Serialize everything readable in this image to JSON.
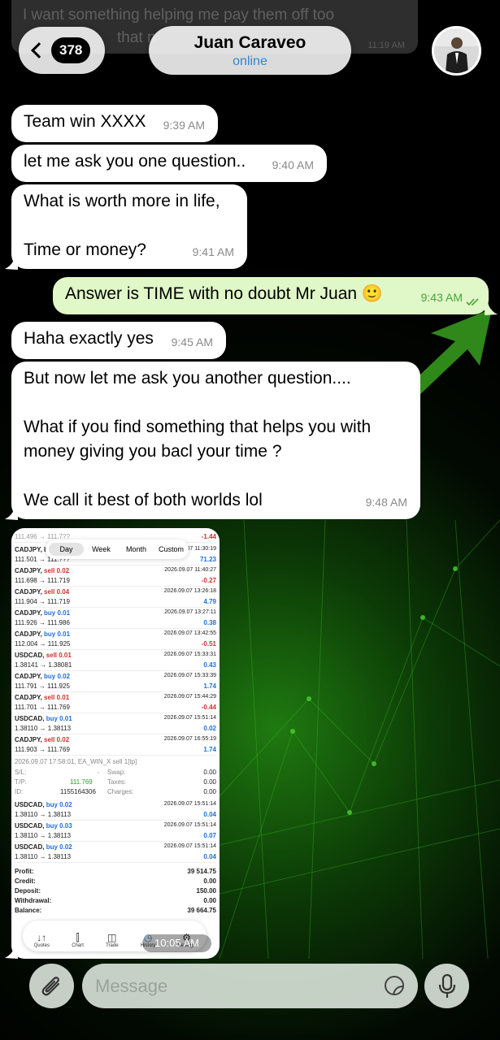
{
  "header": {
    "unread_count": "378",
    "contact_name": "Juan Caraveo",
    "contact_status": "online"
  },
  "ghost_message": {
    "text": "I want something helping me pay them off too",
    "line2": "that n",
    "time": "11:19 AM"
  },
  "messages": [
    {
      "dir": "in",
      "text": "Team win XXXX",
      "time": "9:39 AM"
    },
    {
      "dir": "in",
      "text": "let me ask you one question..",
      "time": "9:40 AM"
    },
    {
      "dir": "in",
      "text": "What is worth more in life,\n\nTime or money?",
      "time": "9:41 AM"
    },
    {
      "dir": "out",
      "text": "Answer is TIME with no doubt Mr Juan 🙂",
      "time": "9:43 AM"
    },
    {
      "dir": "in",
      "text": "Haha exactly yes",
      "time": "9:45 AM"
    },
    {
      "dir": "in",
      "text": "But now let me ask you another question....\n\nWhat if you find something that helps you with money giving you bacl your time ?\n\nWe call it best of both worlds lol",
      "time": "9:48 AM"
    }
  ],
  "screenshot_attachment": {
    "time": "10:05 AM",
    "segment": [
      "Day",
      "Week",
      "Month",
      "Custom"
    ],
    "partial_rows": [
      {
        "line1": "111.496 → 111.7??",
        "value": "-1.44"
      },
      {
        "pair": "CADJPY, bu",
        "side": "",
        "line2": "111.501 → 111.???",
        "stamp": "2026.09.07 11:30:19",
        "value": "71.23"
      }
    ],
    "trades": [
      {
        "pair": "CADJPY,",
        "side": "sell 0.02",
        "prices": "111.698 → 111.719",
        "stamp": "2026.09.07 11:40:27",
        "value": "-0.27",
        "kind": "sell"
      },
      {
        "pair": "CADJPY,",
        "side": "sell 0.04",
        "prices": "111.904 → 111.719",
        "stamp": "2026.09.07 13:26:18",
        "value": "4.79",
        "kind": "sell"
      },
      {
        "pair": "CADJPY,",
        "side": "buy 0.01",
        "prices": "111.926 → 111.986",
        "stamp": "2026.09.07 13:27:11",
        "value": "0.38",
        "kind": "buy"
      },
      {
        "pair": "CADJPY,",
        "side": "buy 0.01",
        "prices": "112.004 → 111.925",
        "stamp": "2026.09.07 13:42:55",
        "value": "-0.51",
        "kind": "buy"
      },
      {
        "pair": "USDCAD,",
        "side": "sell 0.01",
        "prices": "1.38141 → 1.38081",
        "stamp": "2026.09.07 15:33:31",
        "value": "0.43",
        "kind": "sell"
      },
      {
        "pair": "CADJPY,",
        "side": "buy 0.02",
        "prices": "111.791 → 111.925",
        "stamp": "2026.09.07 15:33:39",
        "value": "1.74",
        "kind": "buy"
      },
      {
        "pair": "CADJPY,",
        "side": "sell 0.01",
        "prices": "111.701 → 111.769",
        "stamp": "2026.09.07 15:44:29",
        "value": "-0.44",
        "kind": "sell"
      },
      {
        "pair": "USDCAD,",
        "side": "buy 0.01",
        "prices": "1.38110 → 1.38113",
        "stamp": "2026.09.07 15:51:14",
        "value": "0.02",
        "kind": "buy"
      },
      {
        "pair": "CADJPY,",
        "side": "sell 0.02",
        "prices": "111.903 → 111.769",
        "stamp": "2026.09.07 16:55:19",
        "value": "1.74",
        "kind": "sell"
      }
    ],
    "detail": {
      "header": "2026.09.07 17:58:01, EA_WIN_X sell 1[tp]",
      "sl_label": "S/L:",
      "sl_value": "-",
      "swap_label": "Swap:",
      "swap_value": "0.00",
      "tp_label": "T/P:",
      "tp_value": "111.769",
      "taxes_label": "Taxes:",
      "taxes_value": "0.00",
      "id_label": "ID:",
      "id_value": "1155164306",
      "charges_label": "Charges:",
      "charges_value": "0.00"
    },
    "trades2": [
      {
        "pair": "USDCAD,",
        "side": "buy 0.02",
        "prices": "1.38110 → 1.38113",
        "stamp": "2026.09.07 15:51:14",
        "value": "0.04",
        "kind": "buy"
      },
      {
        "pair": "USDCAD,",
        "side": "buy 0.03",
        "prices": "1.38110 → 1.38113",
        "stamp": "2026.09.07 15:51:14",
        "value": "0.07",
        "kind": "buy"
      },
      {
        "pair": "USDCAD,",
        "side": "buy 0.02",
        "prices": "1.38110 → 1.38113",
        "stamp": "2026.09.07 15:51:14",
        "value": "0.04",
        "kind": "buy"
      }
    ],
    "totals": [
      {
        "label": "Profit:",
        "value": "39 514.75"
      },
      {
        "label": "Credit:",
        "value": "0.00"
      },
      {
        "label": "Deposit:",
        "value": "150.00"
      },
      {
        "label": "Withdrawal:",
        "value": "0.00"
      },
      {
        "label": "Balance:",
        "value": "39 664.75"
      }
    ],
    "tabs": [
      {
        "label": "Quotes",
        "icon": "↓↑"
      },
      {
        "label": "Chart",
        "icon": "⫿"
      },
      {
        "label": "Trade",
        "icon": "◫"
      },
      {
        "label": "History",
        "icon": "◷"
      },
      {
        "label": "Settings",
        "icon": "⚙"
      }
    ]
  },
  "composer": {
    "placeholder": "Message"
  },
  "colors": {
    "outgoing": "#e0f7c8",
    "incoming": "#ffffff",
    "accent": "#2f87d8",
    "sell": "#d32f2f",
    "buy": "#1e6fd9"
  }
}
